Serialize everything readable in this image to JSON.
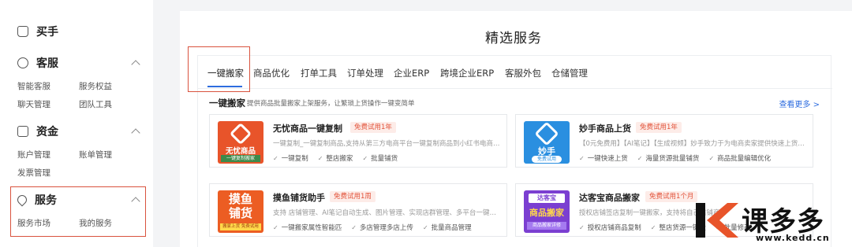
{
  "sidebar": {
    "buyer": {
      "label": "买手"
    },
    "service_cs": {
      "label": "客服",
      "items": [
        "智能客服",
        "服务权益",
        "聊天管理",
        "团队工具"
      ]
    },
    "funds": {
      "label": "资金",
      "items": [
        "账户管理",
        "账单管理",
        "发票管理"
      ]
    },
    "services": {
      "label": "服务",
      "items": [
        "服务市场",
        "我的服务"
      ]
    }
  },
  "main": {
    "title": "精选服务",
    "tabs": [
      "一键搬家",
      "商品优化",
      "打单工具",
      "订单处理",
      "企业ERP",
      "跨境企业ERP",
      "客服外包",
      "仓储管理"
    ],
    "section": {
      "title": "一键搬家",
      "desc": "提供商品批量搬家上架服务，让繁琐上货操作一键变简单",
      "more": "查看更多 >"
    },
    "cards": [
      {
        "name": "无忧商品一键复制",
        "badge": "免费试用1年",
        "desc": "一键复制_一键复制商品,支持从第三方电商平台一键复制商品到小红书电商平台,...",
        "features": [
          "一键复制",
          "整店搬家",
          "批量铺货"
        ],
        "logo": {
          "line1": "无忧商品",
          "line2": "一键复制搬家",
          "color": "#e8542a"
        }
      },
      {
        "name": "妙手商品上货",
        "badge": "免费试用1年",
        "desc": "【0元免费用】【AI笔记】【生成视频】妙手致力于为电商卖家提供快速上货、店...",
        "features": [
          "一键快速上货",
          "海量货源批量铺货",
          "商品批量编辑优化"
        ],
        "logo": {
          "line1": "妙手",
          "line2": "免费试用",
          "color": "#2a8fe0"
        }
      },
      {
        "name": "摸鱼铺货助手",
        "badge": "免费试用1周",
        "desc": "支持 店铺管理、AI笔记自动生成、图片管理、实现店群管理、多平台一键上货到...",
        "features": [
          "一键搬家属性智能匹",
          "多店管理多店上传",
          "批量商品管理"
        ],
        "logo": {
          "line1": "摸鱼",
          "line2": "铺货",
          "line3": "搬家上货 免费试用",
          "color": "#ec5d23"
        }
      },
      {
        "name": "达客宝商品搬家",
        "badge": "免费试用1个月",
        "desc": "授权店铺签店复制一键搬家，支持将自己店铺商品...",
        "features": [
          "授权店铺商品复制",
          "整店货源一键搬",
          "批量修改"
        ],
        "logo": {
          "line1": "达客宝",
          "line2": "商品搬家",
          "line3": "商品搬家详修",
          "color": "#7b3fd1"
        }
      }
    ]
  },
  "watermark": {
    "brand": "课多多",
    "url": "www.kedd.cn"
  }
}
